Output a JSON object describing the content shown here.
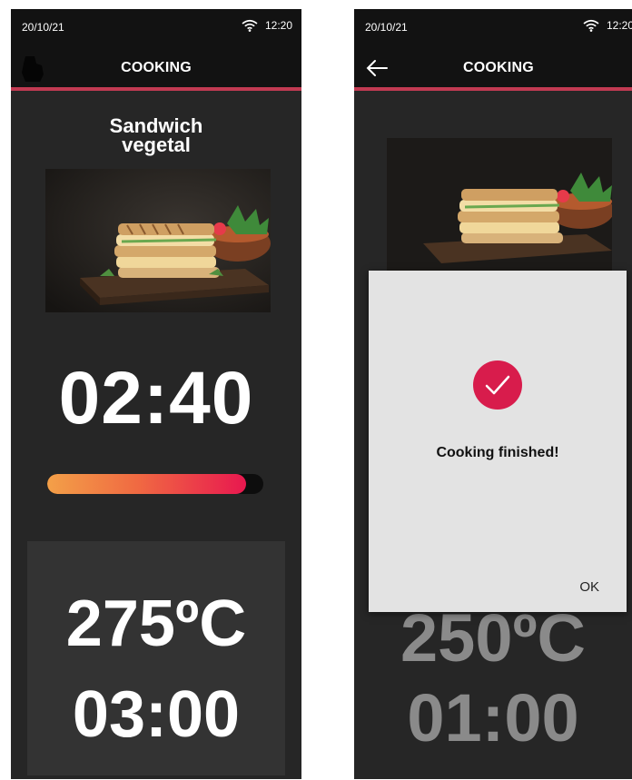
{
  "left": {
    "status": {
      "date": "20/10/21",
      "time": "12:20"
    },
    "appbar": {
      "title": "COOKING"
    },
    "dish": {
      "name_line1": "Sandwich",
      "name_line2": "vegetal"
    },
    "timer": "02:40",
    "progress": 0.92,
    "temperature": "275ºC",
    "duration": "03:00"
  },
  "right": {
    "status": {
      "date": "20/10/21",
      "time": "12:20"
    },
    "appbar": {
      "title": "COOKING"
    },
    "temperature": "250ºC",
    "duration": "01:00",
    "dialog": {
      "message": "Cooking finished!",
      "ok_label": "OK"
    }
  },
  "colors": {
    "accent": "#c23a52",
    "success": "#d81c4c",
    "progress_start": "#f3a048",
    "progress_end": "#e8184f"
  },
  "icons": [
    "wifi-icon",
    "back-arrow-icon",
    "checkmark-icon",
    "dish-photo"
  ]
}
